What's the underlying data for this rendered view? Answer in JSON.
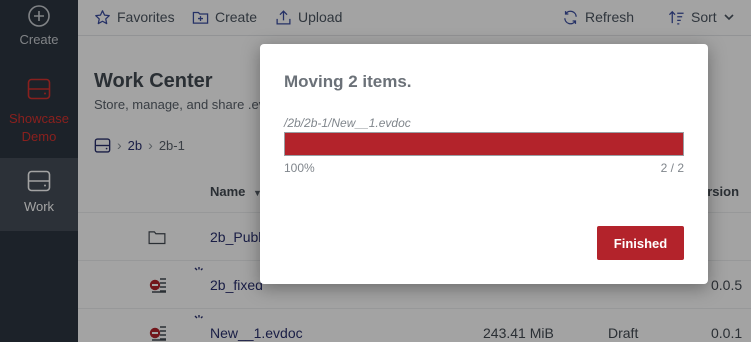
{
  "sidebar": {
    "items": [
      {
        "label": "Create",
        "icon": "plus-circle-icon"
      },
      {
        "label": "Showcase Demo",
        "icon": "drive-icon"
      },
      {
        "label": "Work",
        "icon": "drive-icon"
      }
    ],
    "active": "Work"
  },
  "toolbar": {
    "favorites": "Favorites",
    "create": "Create",
    "upload": "Upload",
    "refresh": "Refresh",
    "sort": "Sort"
  },
  "main": {
    "title": "Work Center",
    "subtitle": "Store, manage, and share .ev",
    "breadcrumb": [
      "2b",
      "2b-1"
    ],
    "columns": {
      "name": "Name",
      "version": "ersion"
    },
    "rows": [
      {
        "icon": "folder-icon",
        "name": "2b_Publ",
        "size": "",
        "status": "",
        "version": ""
      },
      {
        "icon": "evdoc-file-icon",
        "name": "2b_fixed",
        "size": "",
        "status": "",
        "version": "0.0.5"
      },
      {
        "icon": "evdoc-file-icon",
        "name": "New__1.evdoc",
        "size": "243.41 MiB",
        "status": "Draft",
        "version": "0.0.1"
      }
    ]
  },
  "modal": {
    "title": "Moving 2 items.",
    "current_path": "/2b/2b-1/New__1.evdoc",
    "progress": 1.0,
    "percent_label": "100%",
    "count_label": "2 / 2",
    "button": "Finished"
  },
  "colors": {
    "accent": "#b3232b",
    "sidebar_bg": "#2d3640",
    "sidebar_active": "#454e58",
    "link": "#29306e",
    "showcase": "#d6332f"
  }
}
